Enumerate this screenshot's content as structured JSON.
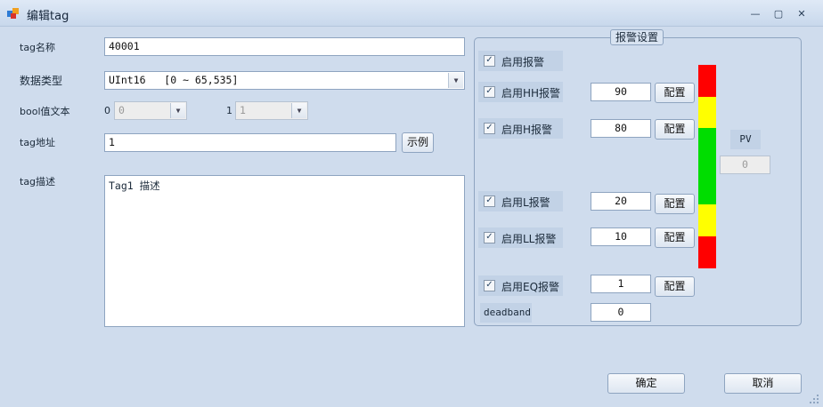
{
  "window": {
    "title": "编辑tag",
    "minimize": "—",
    "restore": "▢",
    "close": "✕"
  },
  "form": {
    "tag_name_label": "tag名称",
    "tag_name_value": "40001",
    "data_type_label": "数据类型",
    "data_type_value": "UInt16   [0 ~ 65,535]",
    "bool_text_label": "bool值文本",
    "bool0_label": "0",
    "bool0_value": "0",
    "bool1_label": "1",
    "bool1_value": "1",
    "tag_addr_label": "tag地址",
    "tag_addr_value": "1",
    "example_button": "示例",
    "tag_desc_label": "tag描述",
    "tag_desc_value": "Tag1 描述"
  },
  "alarm": {
    "legend": "报警设置",
    "rows": [
      {
        "label": "启用报警",
        "checked": "✓"
      },
      {
        "label": "启用HH报警",
        "checked": "✓",
        "value": "90",
        "button": "配置"
      },
      {
        "label": "启用H报警",
        "checked": "✓",
        "value": "80",
        "button": "配置"
      },
      {
        "label": "启用L报警",
        "checked": "✓",
        "value": "20",
        "button": "配置"
      },
      {
        "label": "启用LL报警",
        "checked": "✓",
        "value": "10",
        "button": "配置"
      },
      {
        "label": "启用EQ报警",
        "checked": "✓",
        "value": "1",
        "button": "配置"
      }
    ],
    "deadband_label": "deadband",
    "deadband_value": "0",
    "pv_label": "PV",
    "pv_value": "0",
    "bar_colors": {
      "hh": "#ff0000",
      "h": "#ffff00",
      "normal": "#00dd00",
      "l": "#ffff00",
      "ll": "#ff0000"
    }
  },
  "footer": {
    "ok_button": "确定",
    "cancel_button": "取消"
  }
}
